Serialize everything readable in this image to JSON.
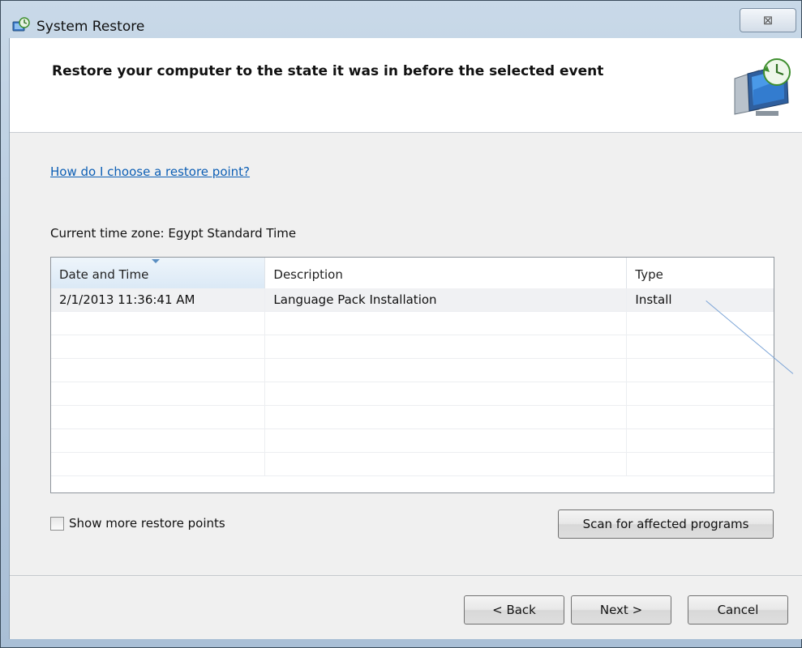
{
  "window": {
    "title": "System Restore",
    "close_glyph": "⊠"
  },
  "header": {
    "title": "Restore your computer to the state it was in before the selected event",
    "icon": "system-restore-icon"
  },
  "help_link": "How do I choose a restore point?",
  "timezone_text": "Current time zone: Egypt Standard Time",
  "list": {
    "columns": [
      "Date and Time",
      "Description",
      "Type"
    ],
    "rows": [
      {
        "date": "2/1/2013 11:36:41 AM",
        "description": "Language Pack Installation",
        "type": "Install"
      },
      {
        "date": "",
        "description": "",
        "type": ""
      },
      {
        "date": "",
        "description": "",
        "type": ""
      },
      {
        "date": "",
        "description": "",
        "type": ""
      },
      {
        "date": "",
        "description": "",
        "type": ""
      },
      {
        "date": "",
        "description": "",
        "type": ""
      },
      {
        "date": "",
        "description": "",
        "type": ""
      },
      {
        "date": "",
        "description": "",
        "type": ""
      }
    ]
  },
  "checkbox": {
    "label": "Show more restore points",
    "checked": false
  },
  "buttons": {
    "scan": "Scan for affected programs",
    "back": "< Back",
    "next": "Next >",
    "cancel": "Cancel"
  },
  "colors": {
    "link": "#0d5fb5",
    "accent": "#5a8ec2"
  }
}
